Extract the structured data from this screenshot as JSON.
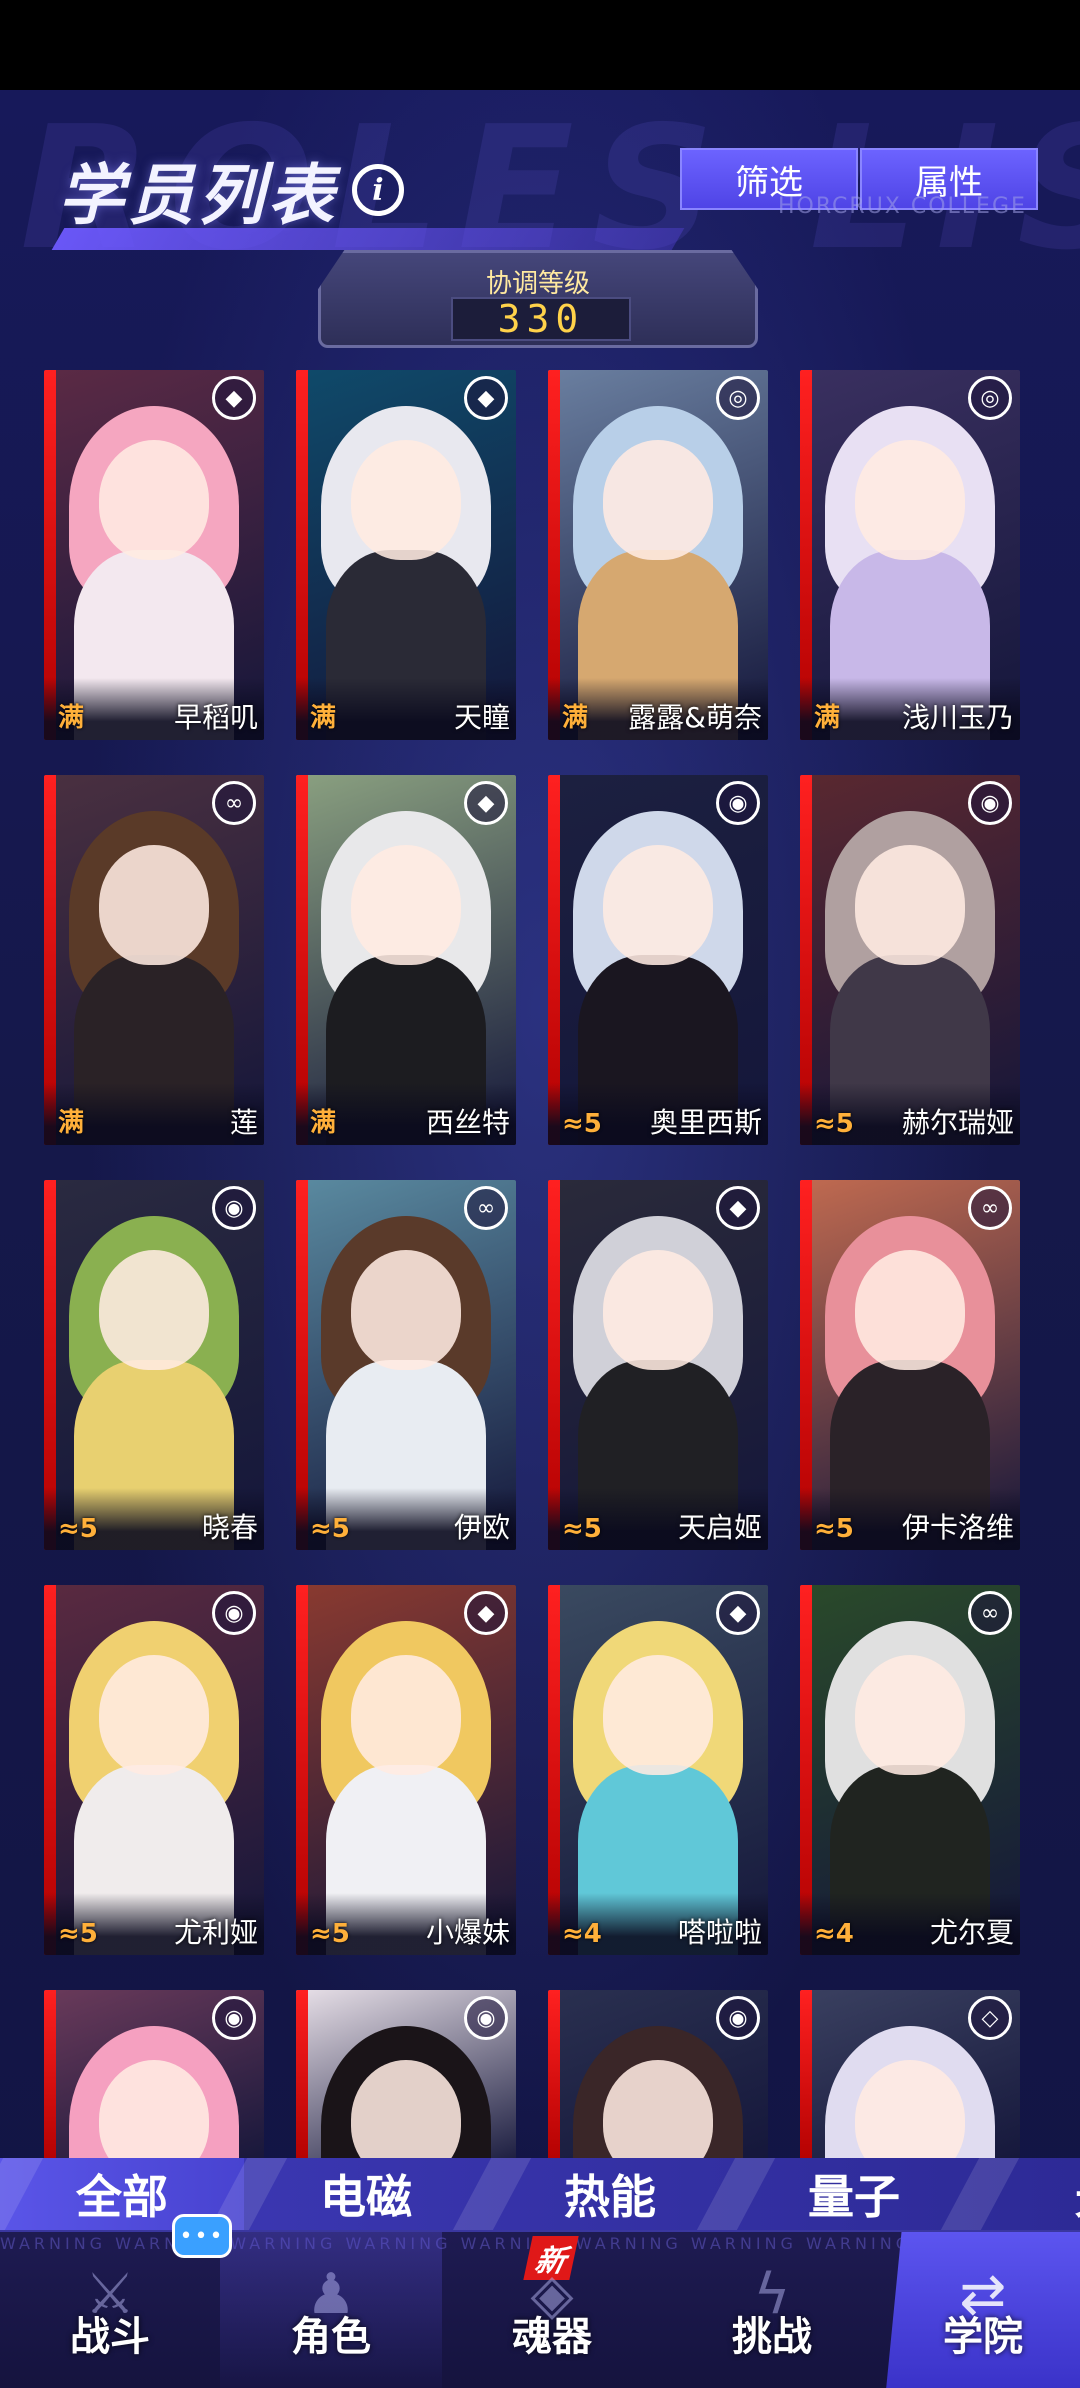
{
  "header": {
    "title": "学员列表",
    "info_icon": "info-icon",
    "buttons": [
      "筛选",
      "属性"
    ],
    "watermark": "ROLES LIST",
    "college_label": "HORCRUX COLLEGE"
  },
  "coordination": {
    "label": "协调等级",
    "value": "330"
  },
  "roster": [
    {
      "name": "早稻叽",
      "rank": "满",
      "attr": "quantum",
      "palette": {
        "bg": "#5b2a45",
        "hair": "#f5a6c0",
        "body": "#f3e8ef"
      }
    },
    {
      "name": "天瞳",
      "rank": "满",
      "attr": "quantum",
      "palette": {
        "bg": "#0f4a6a",
        "hair": "#e8e8ef",
        "body": "#2a2a36"
      }
    },
    {
      "name": "露露&萌奈",
      "rank": "满",
      "attr": "void",
      "palette": {
        "bg": "#6a7fa0",
        "hair": "#b8cfe8",
        "body": "#d6a870"
      }
    },
    {
      "name": "浅川玉乃",
      "rank": "满",
      "attr": "void",
      "palette": {
        "bg": "#3a3060",
        "hair": "#e8e0f3",
        "body": "#c8b8e8"
      }
    },
    {
      "name": "莲",
      "rank": "满",
      "attr": "electric",
      "palette": {
        "bg": "#4a3040",
        "hair": "#5a3a28",
        "body": "#2a2226"
      }
    },
    {
      "name": "西丝特",
      "rank": "满",
      "attr": "quantum",
      "palette": {
        "bg": "#8aa080",
        "hair": "#e8e8ea",
        "body": "#1c1c20"
      }
    },
    {
      "name": "奥里西斯",
      "rank": "5",
      "attr": "thermal",
      "palette": {
        "bg": "#1c2040",
        "hair": "#cfd8ea",
        "body": "#1a1620"
      }
    },
    {
      "name": "赫尔瑞娅",
      "rank": "5",
      "attr": "thermal",
      "palette": {
        "bg": "#5a2830",
        "hair": "#b0a0a0",
        "body": "#403848"
      }
    },
    {
      "name": "晓春",
      "rank": "5",
      "attr": "thermal",
      "palette": {
        "bg": "#2a2a40",
        "hair": "#8ab050",
        "body": "#e8d070"
      }
    },
    {
      "name": "伊欧",
      "rank": "5",
      "attr": "electric",
      "palette": {
        "bg": "#5a8aa0",
        "hair": "#5a3a2a",
        "body": "#e8ecf2"
      }
    },
    {
      "name": "天启姬",
      "rank": "5",
      "attr": "quantum",
      "palette": {
        "bg": "#2a2a3a",
        "hair": "#d0d0d8",
        "body": "#202024"
      }
    },
    {
      "name": "伊卡洛维",
      "rank": "5",
      "attr": "electric",
      "palette": {
        "bg": "#c06a50",
        "hair": "#e8909a",
        "body": "#2a2228"
      }
    },
    {
      "name": "尤利娅",
      "rank": "5",
      "attr": "thermal",
      "palette": {
        "bg": "#5a2a40",
        "hair": "#f0d070",
        "body": "#f0ecec"
      }
    },
    {
      "name": "小爆妹",
      "rank": "5",
      "attr": "quantum",
      "palette": {
        "bg": "#8a3a30",
        "hair": "#f0c860",
        "body": "#f0f0f4"
      }
    },
    {
      "name": "嗒啦啦",
      "rank": "4",
      "attr": "quantum",
      "palette": {
        "bg": "#3a4a60",
        "hair": "#f0d878",
        "body": "#60c8d8"
      }
    },
    {
      "name": "尤尔夏",
      "rank": "4",
      "attr": "electric",
      "palette": {
        "bg": "#2a4a2a",
        "hair": "#e0e0e0",
        "body": "#202420"
      }
    },
    {
      "name": "",
      "rank": "",
      "attr": "thermal",
      "palette": {
        "bg": "#6a3a5a",
        "hair": "#f5a0c0",
        "body": "#f0e0e8"
      }
    },
    {
      "name": "",
      "rank": "",
      "attr": "thermal",
      "palette": {
        "bg": "#e8e0e8",
        "hair": "#1a1418",
        "body": "#e8e4ea"
      }
    },
    {
      "name": "",
      "rank": "",
      "attr": "thermal",
      "palette": {
        "bg": "#2a3050",
        "hair": "#3a2628",
        "body": "#202030"
      }
    },
    {
      "name": "",
      "rank": "",
      "attr": "light",
      "palette": {
        "bg": "#3a4060",
        "hair": "#e0dcf0",
        "body": "#c0c0d8"
      }
    }
  ],
  "filters": [
    "全部",
    "电磁",
    "热能",
    "量子",
    "光"
  ],
  "active_filter": "全部",
  "nav": {
    "items": [
      "战斗",
      "角色",
      "魂器",
      "挑战",
      "学院"
    ],
    "new_badge": "新",
    "warning_text": "WARNING  WARNING  WARNING  WARNING  WARNING  WARNING  WARNING  WARNING  WARNING  WARNING  WARNING  WARNING",
    "chat_icon": "chat-bubble-icon"
  },
  "colors": {
    "accent": "#5a55e8",
    "rank_orange": "#ffb03a",
    "level_gold": "#ffd24a",
    "card_red": "#e01818"
  }
}
